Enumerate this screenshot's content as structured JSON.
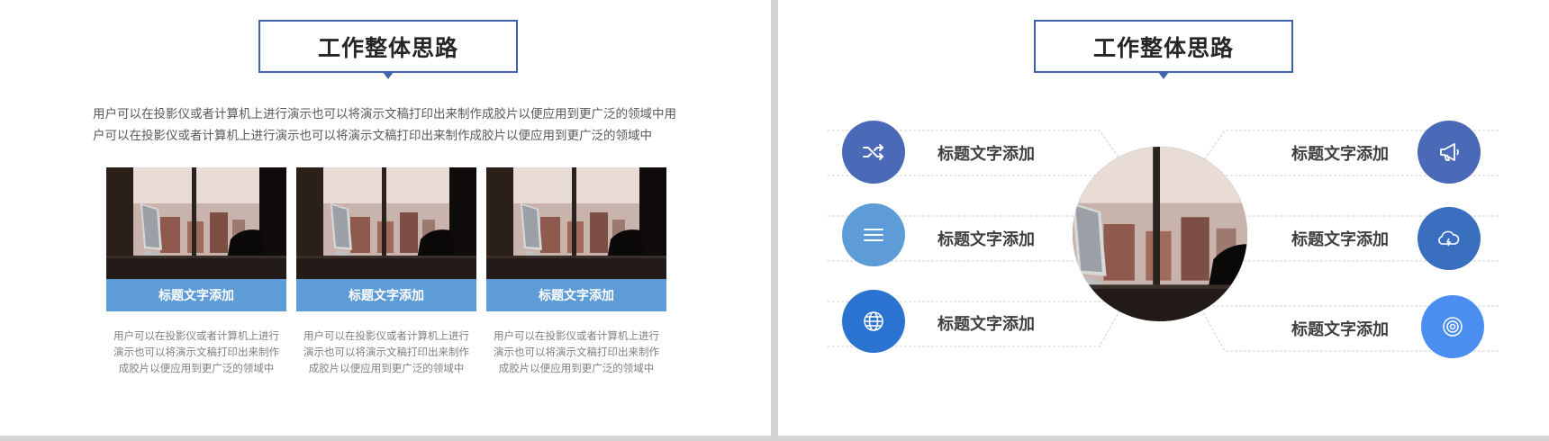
{
  "left_slide": {
    "title": "工作整体思路",
    "intro": "用户可以在投影仪或者计算机上进行演示也可以将演示文稿打印出来制作成胶片以便应用到更广泛的领域中用户可以在投影仪或者计算机上进行演示也可以将演示文稿打印出来制作成胶片以便应用到更广泛的领域中",
    "cards": [
      {
        "caption": "标题文字添加",
        "desc": "用户可以在投影仪或者计算机上进行演示也可以将演示文稿打印出来制作成胶片以便应用到更广泛的领域中"
      },
      {
        "caption": "标题文字添加",
        "desc": "用户可以在投影仪或者计算机上进行演示也可以将演示文稿打印出来制作成胶片以便应用到更广泛的领域中"
      },
      {
        "caption": "标题文字添加",
        "desc": "用户可以在投影仪或者计算机上进行演示也可以将演示文稿打印出来制作成胶片以便应用到更广泛的领域中"
      }
    ]
  },
  "right_slide": {
    "title": "工作整体思路",
    "left_items": [
      {
        "label": "标题文字添加",
        "icon": "shuffle-icon",
        "color": "#4a6ab8"
      },
      {
        "label": "标题文字添加",
        "icon": "menu-icon",
        "color": "#5d9cd6"
      },
      {
        "label": "标题文字添加",
        "icon": "globe-icon",
        "color": "#2a73d0"
      }
    ],
    "right_items": [
      {
        "label": "标题文字添加",
        "icon": "megaphone-icon",
        "color": "#4a6ab8"
      },
      {
        "label": "标题文字添加",
        "icon": "cloud-icon",
        "color": "#3a6fc0"
      },
      {
        "label": "标题文字添加",
        "icon": "target-icon",
        "color": "#4a8ef0"
      }
    ]
  },
  "colors": {
    "accent": "#3e64ad",
    "caption_bar": "#5d9cd6"
  }
}
